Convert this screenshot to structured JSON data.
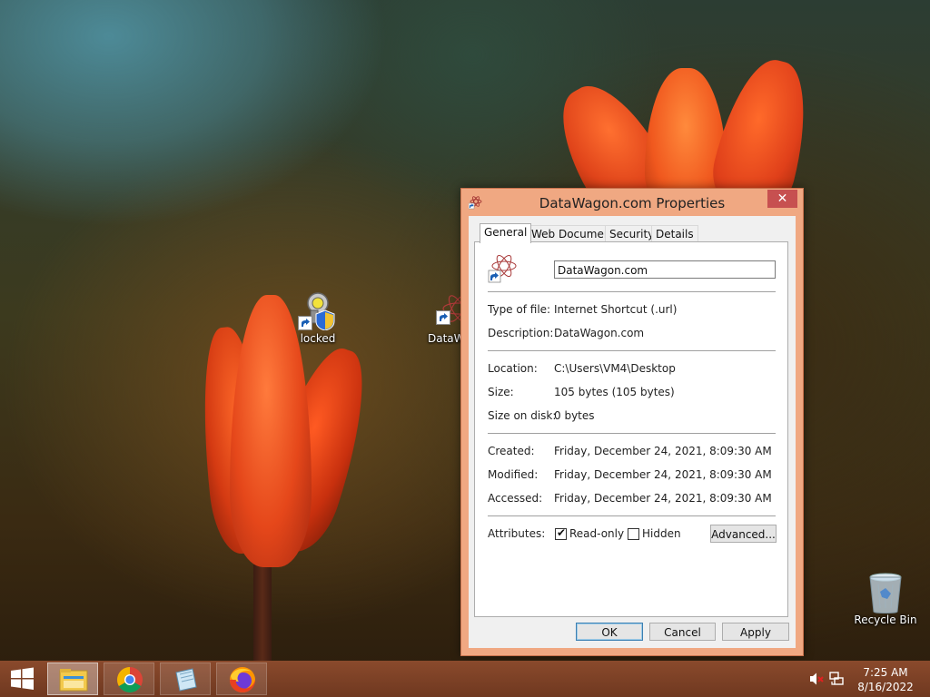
{
  "desktop": {
    "icons": [
      {
        "label": "locked"
      },
      {
        "label": "DataW"
      },
      {
        "label": "Recycle Bin"
      }
    ]
  },
  "dialog": {
    "title": "DataWagon.com Properties",
    "close_label": "✕",
    "tabs": [
      {
        "label": "General",
        "active": true
      },
      {
        "label": "Web Document",
        "active": false
      },
      {
        "label": "Security",
        "active": false
      },
      {
        "label": "Details",
        "active": false
      }
    ],
    "name_value": "DataWagon.com",
    "type_label": "Type of file:",
    "type_value": "Internet Shortcut (.url)",
    "description_label": "Description:",
    "description_value": "DataWagon.com",
    "location_label": "Location:",
    "location_value": "C:\\Users\\VM4\\Desktop",
    "size_label": "Size:",
    "size_value": "105 bytes (105 bytes)",
    "size_on_disk_label": "Size on disk:",
    "size_on_disk_value": "0 bytes",
    "created_label": "Created:",
    "created_value": "Friday, December 24, 2021, 8:09:30 AM",
    "modified_label": "Modified:",
    "modified_value": "Friday, December 24, 2021, 8:09:30 AM",
    "accessed_label": "Accessed:",
    "accessed_value": "Friday, December 24, 2021, 8:09:30 AM",
    "attributes_label": "Attributes:",
    "readonly_label": "Read-only",
    "readonly_checked": true,
    "hidden_label": "Hidden",
    "hidden_checked": false,
    "advanced_label": "Advanced...",
    "ok_label": "OK",
    "cancel_label": "Cancel",
    "apply_label": "Apply"
  },
  "taskbar": {
    "apps": [
      {
        "icon": "file-explorer-icon",
        "active": true
      },
      {
        "icon": "chrome-icon",
        "active": false
      },
      {
        "icon": "notepad-icon",
        "active": false
      },
      {
        "icon": "firefox-icon",
        "active": false
      }
    ],
    "tray": {
      "volume_icon": "volume-muted-icon",
      "network_icon": "network-icon"
    },
    "clock": {
      "time": "7:25 AM",
      "date": "8/16/2022"
    }
  },
  "colors": {
    "dialog_frame": "#f0a882",
    "close_button": "#c75050",
    "taskbar": "#7a3f26"
  }
}
